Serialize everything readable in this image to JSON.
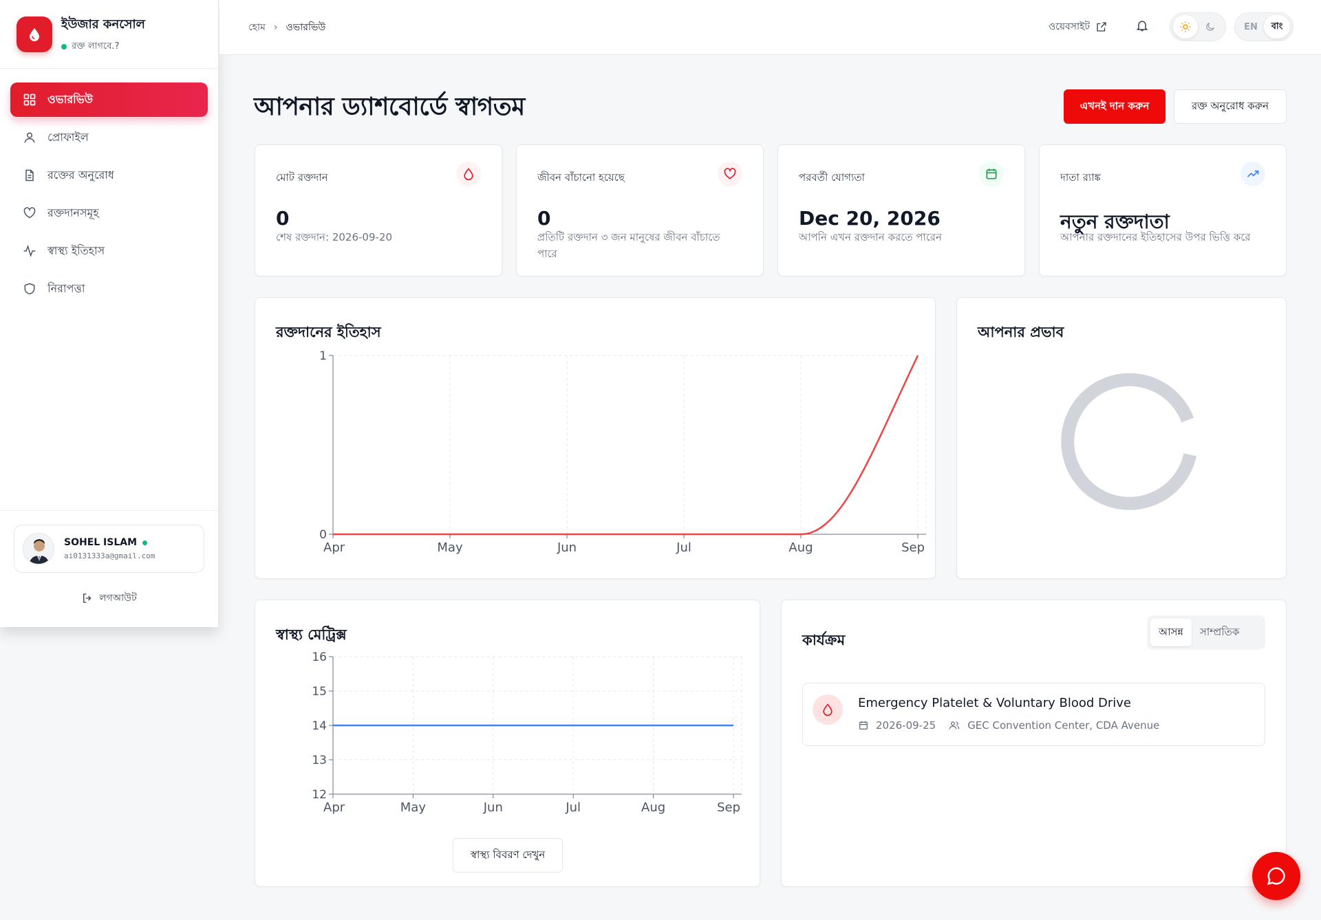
{
  "brand": {
    "title": "ইউজার কনসোল",
    "subtitle": "রক্ত লাগবে.?"
  },
  "sidebar": {
    "items": [
      {
        "label": "ওভারভিউ",
        "icon": "grid-icon",
        "active": true
      },
      {
        "label": "প্রোফাইল",
        "icon": "user-icon"
      },
      {
        "label": "রক্তের অনুরোধ",
        "icon": "document-icon"
      },
      {
        "label": "রক্তদানসমূহ",
        "icon": "heart-icon"
      },
      {
        "label": "স্বাস্থ্য ইতিহাস",
        "icon": "activity-icon"
      },
      {
        "label": "নিরাপত্তা",
        "icon": "shield-icon"
      }
    ]
  },
  "user": {
    "name": "SOHEL ISLAM",
    "email": "ai0131333a@gmail.com",
    "status": "online"
  },
  "logout_label": "লগআউট",
  "header": {
    "breadcrumb": [
      "হোম",
      "ওভারভিউ"
    ],
    "website_label": "ওয়েবসাইট",
    "lang": {
      "en": "EN",
      "bn": "বাং",
      "selected": "বাং"
    },
    "theme": {
      "selected": "light"
    }
  },
  "page": {
    "title": "আপনার ড্যাশবোর্ডে স্বাগতম",
    "donate_now": "এখনই দান করুন",
    "request_blood": "রক্ত অনুরোধ করুন"
  },
  "stats": [
    {
      "label": "মোট রক্তদান",
      "value": "0",
      "sub": "শেষ রক্তদান: 2026-09-20",
      "icon": "droplet-icon",
      "color": "#e11d2b",
      "bg": "#fef2f2"
    },
    {
      "label": "জীবন বাঁচানো হয়েছে",
      "value": "0",
      "sub": "প্রতিটি রক্তদান ৩ জন মানুষের জীবন বাঁচাতে পারে",
      "icon": "heart-icon",
      "color": "#e11d2b",
      "bg": "#fef2f2"
    },
    {
      "label": "পরবর্তী যোগ্যতা",
      "value": "Dec 20, 2026",
      "sub": "আপনি এখন রক্তদান করতে পারেন",
      "icon": "calendar-icon",
      "color": "#16a34a",
      "bg": "#f0fdf4"
    },
    {
      "label": "দাতা র‍্যাঙ্ক",
      "value": "নতুন রক্তদাতা",
      "sub": "আপনার রক্তদানের ইতিহাসের উপর ভিত্তি করে",
      "icon": "trending-up-icon",
      "color": "#3b82f6",
      "bg": "#eff6ff"
    }
  ],
  "donation_history": {
    "title": "রক্তদানের ইতিহাস",
    "chart_data": {
      "type": "line",
      "x": [
        "Apr",
        "May",
        "Jun",
        "Jul",
        "Aug",
        "Sep"
      ],
      "series": [
        {
          "values": [
            0,
            0,
            0,
            0,
            0,
            1
          ],
          "color": "#ef4444"
        }
      ],
      "ylim": [
        0,
        1
      ],
      "yticks": [
        0,
        1
      ],
      "grid": true
    }
  },
  "impact": {
    "title": "আপনার প্রভাব"
  },
  "health_metrics": {
    "title": "স্বাস্থ্য মেট্রিক্স",
    "button": "স্বাস্থ্য বিবরণ দেখুন",
    "chart_data": {
      "type": "line",
      "x": [
        "Apr",
        "May",
        "Jun",
        "Jul",
        "Aug",
        "Sep"
      ],
      "series": [
        {
          "values": [
            14,
            14,
            14,
            14,
            14,
            14
          ],
          "color": "#3b82f6"
        }
      ],
      "ylim": [
        12,
        16
      ],
      "yticks": [
        12,
        13,
        14,
        15,
        16
      ],
      "grid": true
    }
  },
  "activities": {
    "title": "কার্যক্রম",
    "tabs": [
      "আসন্ন",
      "সাম্প্রতিক"
    ],
    "selected_tab": "আসন্ন",
    "events": [
      {
        "title": "Emergency Platelet & Voluntary Blood Drive",
        "date": "2026-09-25",
        "location": "GEC Convention Center, CDA Avenue"
      }
    ]
  },
  "colors": {
    "accent": "#e11d2b",
    "primary_button": "#ef0a0a"
  }
}
